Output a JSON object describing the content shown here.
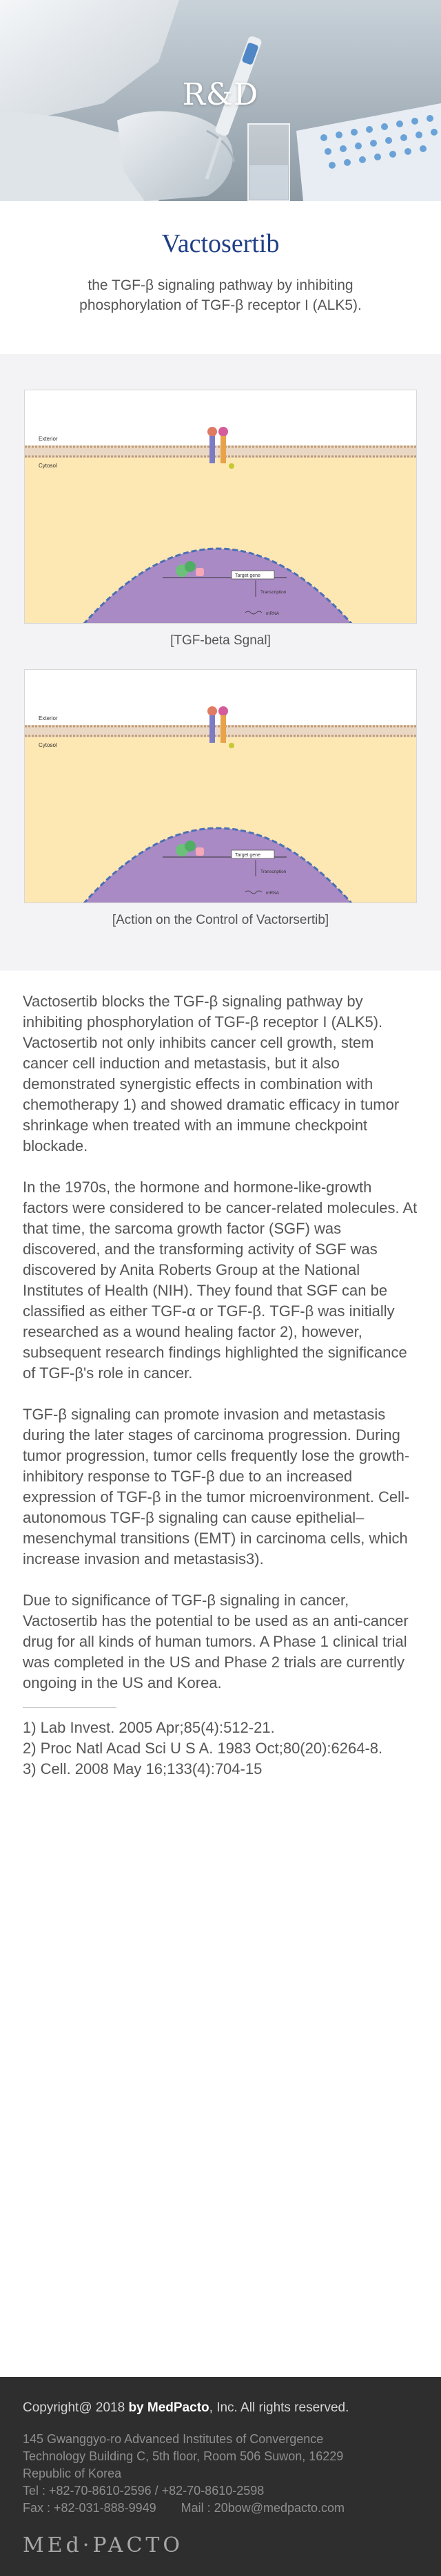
{
  "hero": {
    "title": "R&D"
  },
  "intro": {
    "title": "Vactosertib",
    "subtitle_line1": "the TGF-β signaling pathway by inhibiting",
    "subtitle_line2": "phosphorylation of TGF-β receptor I (ALK5)."
  },
  "figures": [
    {
      "caption": "[TGF-beta Sgnal]",
      "labels": {
        "exterior": "Exterior",
        "cytosol": "Cytosol",
        "target_gene": "Target gene",
        "transcription": "Transcription",
        "mrna": "mRNA"
      }
    },
    {
      "caption": "[Action on the Control of Vactorsertib]",
      "labels": {
        "exterior": "Exterior",
        "cytosol": "Cytosol",
        "target_gene": "Target gene",
        "transcription": "Transcription",
        "mrna": "mRNA"
      }
    }
  ],
  "content": {
    "paragraphs": [
      "Vactosertib blocks the TGF-β signaling pathway by inhibiting phosphorylation of TGF-β receptor I (ALK5). Vactosertib not only inhibits cancer cell growth, stem cancer cell induction and metastasis, but it also demonstrated synergistic effects in combination with chemotherapy 1) and showed dramatic efficacy in tumor shrinkage when treated with an immune checkpoint blockade.",
      "In the 1970s, the hormone and hormone-like-growth factors were considered to be cancer-related molecules. At that time, the sarcoma growth factor (SGF) was discovered, and the transforming activity of SGF was discovered by Anita Roberts Group at the National Institutes of Health (NIH). They found that SGF can be classified as either TGF-α or TGF-β. TGF-β was initially researched as a wound healing factor 2), however, subsequent research findings highlighted the significance of TGF-β's role in cancer.",
      "TGF-β signaling can promote invasion and metastasis during the later stages of carcinoma progression. During tumor progression, tumor cells frequently lose the growth-inhibitory response to TGF-β due to an increased expression of TGF-β in the tumor microenvironment. Cell-autonomous TGF-β signaling can cause epithelial–mesenchymal transitions (EMT) in carcinoma cells, which increase invasion and metastasis3).",
      "Due to significance of TGF-β signaling in cancer, Vactosertib has the potential to be used as an anti-cancer drug for all kinds of human tumors. A Phase 1 clinical trial was completed in the US and Phase 2 trials are currently ongoing in the US and Korea."
    ],
    "references": [
      "1) Lab Invest. 2005 Apr;85(4):512-21.",
      "2) Proc Natl Acad Sci U S A. 1983 Oct;80(20):6264-8.",
      "3) Cell. 2008 May 16;133(4):704-15"
    ]
  },
  "footer": {
    "copyright_prefix": "Copyright@ 2018 ",
    "copyright_brand": "by MedPacto",
    "copyright_suffix": ", Inc. All rights reserved.",
    "address_line1": "145 Gwanggyo-ro Advanced Institutes of Convergence",
    "address_line2": "Technology Building C, 5th floor, Room 506 Suwon, 16229",
    "address_line3": "Republic of Korea",
    "tel": "Tel : +82-70-8610-2596 / +82-70-8610-2598",
    "fax": "Fax : +82-031-888-9949",
    "mail": "Mail : 20bow@medpacto.com",
    "logo": "MEd·PACTO"
  },
  "colors": {
    "title_blue": "#1f3f86",
    "cytosol": "#fde7b3",
    "nucleus": "#a98ac4",
    "membrane": "#bf9b77",
    "footer_bg": "#2e2e2e"
  }
}
